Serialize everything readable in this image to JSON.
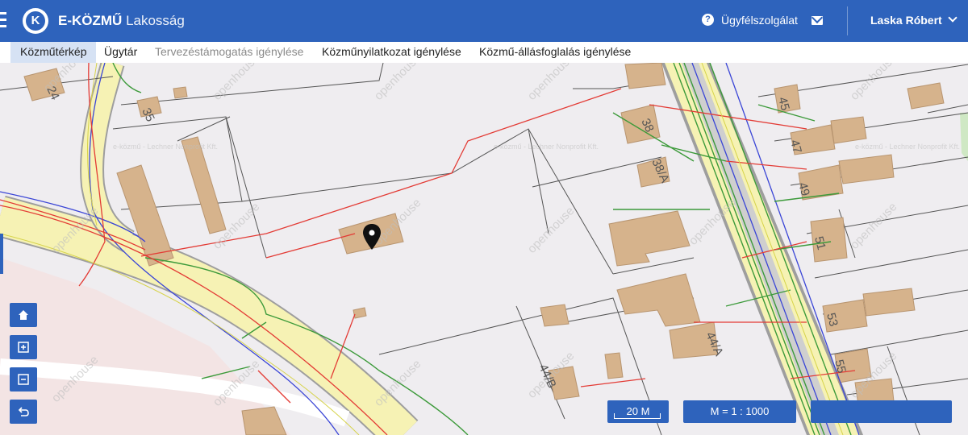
{
  "header": {
    "brand": "E-KÖZMŰ",
    "subtitle": "Lakosság",
    "logo_letter": "K",
    "support_label": "Ügyfélszolgálat",
    "user_name": "Laska Róbert"
  },
  "nav": {
    "tabs": [
      {
        "label": "Közműtérkép",
        "state": "active"
      },
      {
        "label": "Ügytár",
        "state": "normal"
      },
      {
        "label": "Tervezéstámogatás igénylése",
        "state": "disabled"
      },
      {
        "label": "Közműnyilatkozat igénylése",
        "state": "normal"
      },
      {
        "label": "Közmű-állásfoglalás igénylése",
        "state": "normal"
      }
    ]
  },
  "map": {
    "watermark_brand": "openhouse",
    "watermark_provider": "e-közmű - Lechner Nonprofit Kft.",
    "house_numbers": [
      "24",
      "35",
      "38",
      "38/A",
      "45",
      "47",
      "49",
      "51",
      "53",
      "55",
      "44/A",
      "44/B"
    ],
    "controls": {
      "home_icon": "home-icon",
      "zoom_in_icon": "zoom-in-icon",
      "zoom_out_icon": "zoom-out-icon",
      "back_icon": "undo-icon"
    },
    "scale_label": "20 M",
    "ratio_label": "M = 1 : 1000",
    "extra_label": ""
  },
  "colors": {
    "header_blue": "#2e63bc",
    "road_yellow": "#f6f2b4",
    "building": "#d6b38c",
    "electric_red": "#e33b35",
    "gas_green": "#3c9a3a",
    "water_blue": "#3a45d6"
  }
}
